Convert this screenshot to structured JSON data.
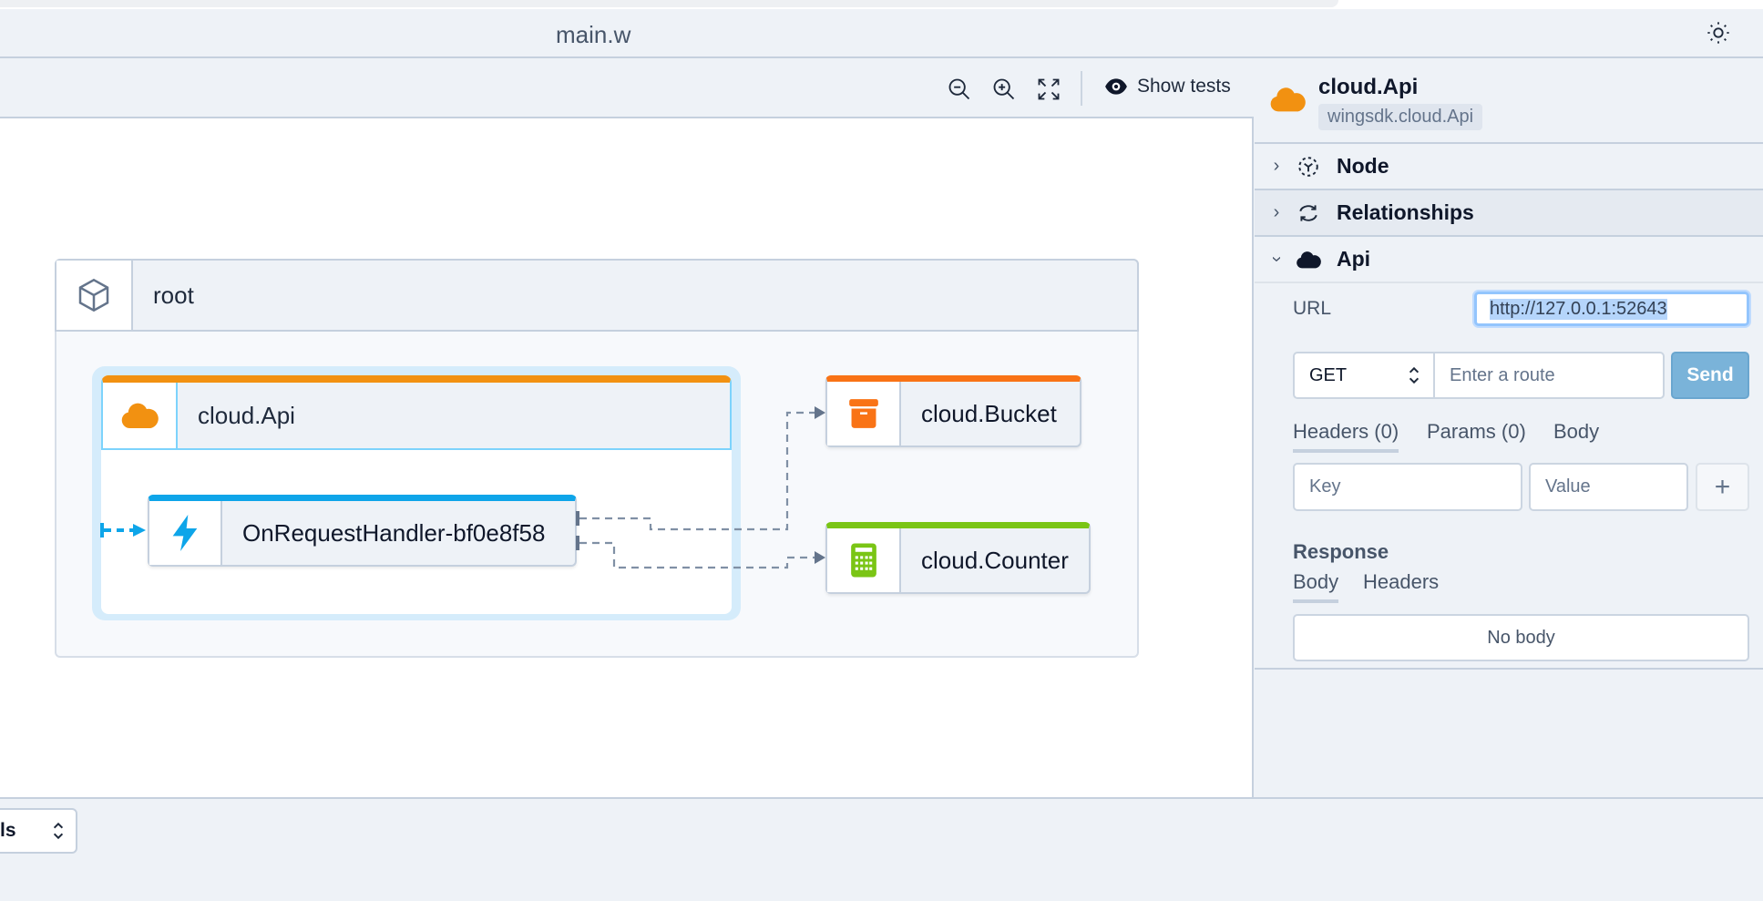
{
  "window": {
    "title": "main.w",
    "theme_icon": "sun-icon"
  },
  "toolbar": {
    "zoom_out": "zoom-out-icon",
    "zoom_in": "zoom-in-icon",
    "fit": "fit-view-icon",
    "show_tests_label": "Show tests"
  },
  "diagram": {
    "root": {
      "label": "root"
    },
    "api": {
      "label": "cloud.Api",
      "color": "#f29111"
    },
    "handler": {
      "label": "OnRequestHandler-bf0e8f58",
      "color": "#0ea5e9"
    },
    "bucket": {
      "label": "cloud.Bucket",
      "color": "#f97316"
    },
    "counter": {
      "label": "cloud.Counter",
      "color": "#7ac515"
    },
    "edges": [
      {
        "from": "OnRequestHandler-bf0e8f58",
        "to": "cloud.Bucket"
      },
      {
        "from": "OnRequestHandler-bf0e8f58",
        "to": "cloud.Counter"
      }
    ]
  },
  "panel": {
    "title": "cloud.Api",
    "type": "wingsdk.cloud.Api",
    "sections": [
      {
        "label": "Node",
        "expanded": false
      },
      {
        "label": "Relationships",
        "expanded": false
      },
      {
        "label": "Api",
        "expanded": true
      }
    ],
    "api": {
      "url_label": "URL",
      "url_value": "http://127.0.0.1:52643",
      "method": "GET",
      "route_placeholder": "Enter a route",
      "send_label": "Send",
      "request_tabs": [
        "Headers (0)",
        "Params (0)",
        "Body"
      ],
      "key_placeholder": "Key",
      "value_placeholder": "Value",
      "add_label": "+",
      "response_label": "Response",
      "response_tabs": [
        "Body",
        "Headers"
      ],
      "response_body": "No body"
    }
  },
  "bottombar": {
    "select_value": "ls"
  }
}
